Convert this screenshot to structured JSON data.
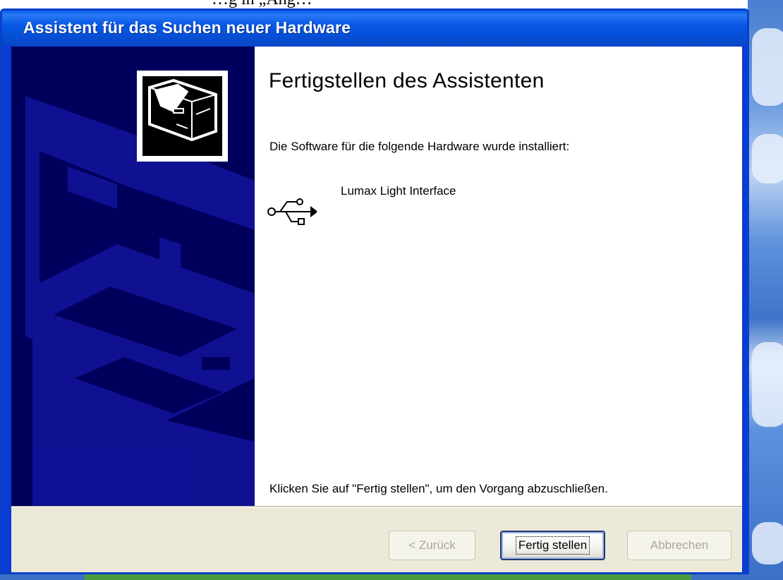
{
  "background": {
    "top_text": "…g in „Ang…"
  },
  "window": {
    "title": "Assistent für das Suchen neuer Hardware"
  },
  "content": {
    "heading": "Fertigstellen des Assistenten",
    "installed_text": "Die Software für die folgende Hardware wurde installiert:",
    "device_name": "Lumax Light Interface",
    "device_icon": "usb-icon",
    "finish_hint": "Klicken Sie auf \"Fertig stellen\", um den Vorgang abzuschließen."
  },
  "buttons": {
    "back_label": "< Zurück",
    "finish_label": "Fertig stellen",
    "cancel_label": "Abbrechen"
  },
  "colors": {
    "titlebar": "#0758e5",
    "side_panel": "#00005c",
    "dialog_face": "#ece9d8",
    "disabled_text": "#aca899"
  }
}
